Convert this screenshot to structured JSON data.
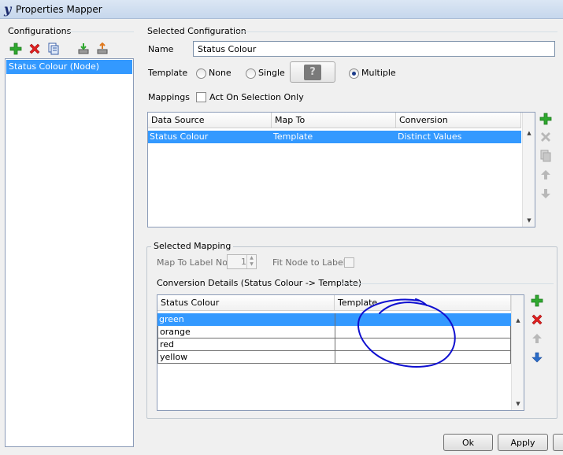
{
  "window": {
    "title": "Properties Mapper",
    "app_icon_glyph": "y"
  },
  "configurations": {
    "heading": "Configurations",
    "toolbar": [
      "add-icon",
      "remove-icon",
      "copy-icon",
      "import-icon",
      "export-icon"
    ],
    "items": [
      {
        "label": "Status Colour (Node)",
        "selected": true
      }
    ]
  },
  "selected_configuration": {
    "heading": "Selected Configuration",
    "name_label": "Name",
    "name_value": "Status Colour",
    "template_label": "Template",
    "template_options": {
      "none": "None",
      "single": "Single",
      "multiple": "Multiple",
      "selected": "Multiple"
    },
    "help_glyph": "?",
    "mappings_label": "Mappings",
    "act_on_selection_label": "Act On Selection Only",
    "act_on_selection_checked": false,
    "mappings_table": {
      "columns": [
        "Data Source",
        "Map To",
        "Conversion"
      ],
      "rows": [
        {
          "data_source": "Status Colour",
          "map_to": "Template",
          "conversion": "Distinct Values",
          "selected": true
        }
      ]
    },
    "side_toolbar": [
      "add-icon",
      "remove-icon",
      "copy-icon",
      "move-up-icon",
      "move-down-icon"
    ]
  },
  "selected_mapping": {
    "heading": "Selected Mapping",
    "map_to_label_no_label": "Map To Label No.",
    "map_to_label_no_value": "1",
    "fit_node_to_label_label": "Fit Node to Label",
    "conversion_details_heading": "Conversion Details (Status Colour -> Template)",
    "conversion_table": {
      "columns": [
        "Status Colour",
        "Template"
      ],
      "rows": [
        {
          "status_colour": "green",
          "template": "",
          "selected": true
        },
        {
          "status_colour": "orange",
          "template": ""
        },
        {
          "status_colour": "red",
          "template": ""
        },
        {
          "status_colour": "yellow",
          "template": ""
        }
      ]
    },
    "side_toolbar": [
      "add-icon",
      "remove-icon",
      "move-up-icon",
      "move-down-icon"
    ]
  },
  "footer": {
    "ok_label": "Ok",
    "apply_label": "Apply"
  },
  "colors": {
    "selection": "#3399ff",
    "annotation": "#1010d0",
    "add_green": "#2fa82f",
    "remove_red": "#e02020",
    "arrow_blue": "#2a6cc8"
  }
}
